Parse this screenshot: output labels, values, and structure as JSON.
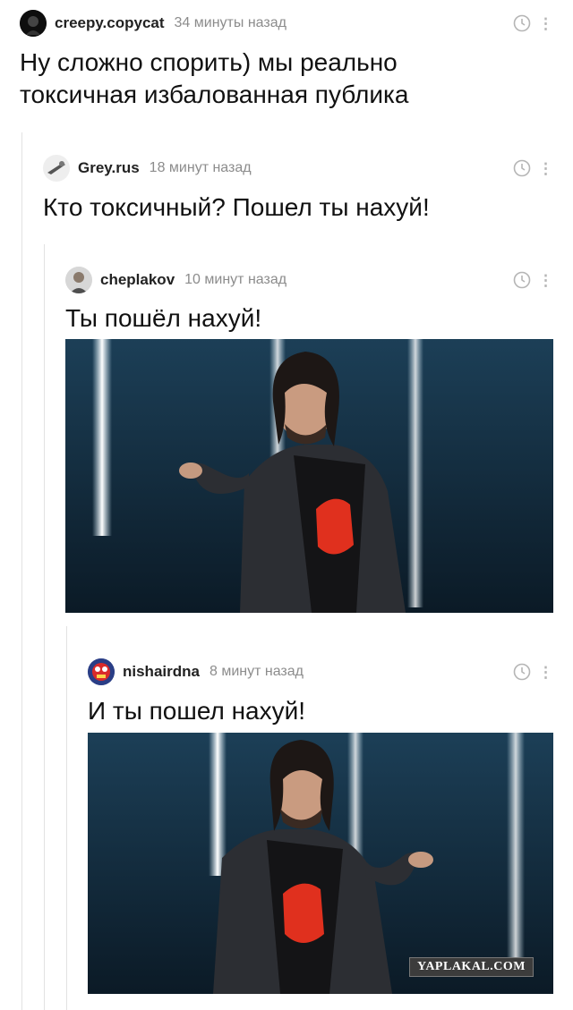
{
  "comments": [
    {
      "author": "creepy.copycat",
      "time": "34 минуты назад",
      "text_lines": [
        "Ну сложно спорить) мы реально",
        "токсичная избалованная публика"
      ]
    },
    {
      "author": "Grey.rus",
      "time": "18 минут назад",
      "text_lines": [
        "Кто токсичный? Пошел ты нахуй!"
      ]
    },
    {
      "author": "cheplakov",
      "time": "10 минут назад",
      "text_lines": [
        "Ты пошёл нахуй!"
      ]
    },
    {
      "author": "nishairdna",
      "time": "8 минут назад",
      "text_lines": [
        "И ты пошел нахуй!"
      ]
    }
  ],
  "icons": {
    "time": "clock-icon",
    "more": "more-vertical-icon"
  },
  "watermark": "YAPLAKAL.COM",
  "colors": {
    "meta": "#8c8c8c",
    "thread_line": "#e2e2e2",
    "photo_bg": "#122a3b",
    "shirt_logo": "#e0301e"
  }
}
